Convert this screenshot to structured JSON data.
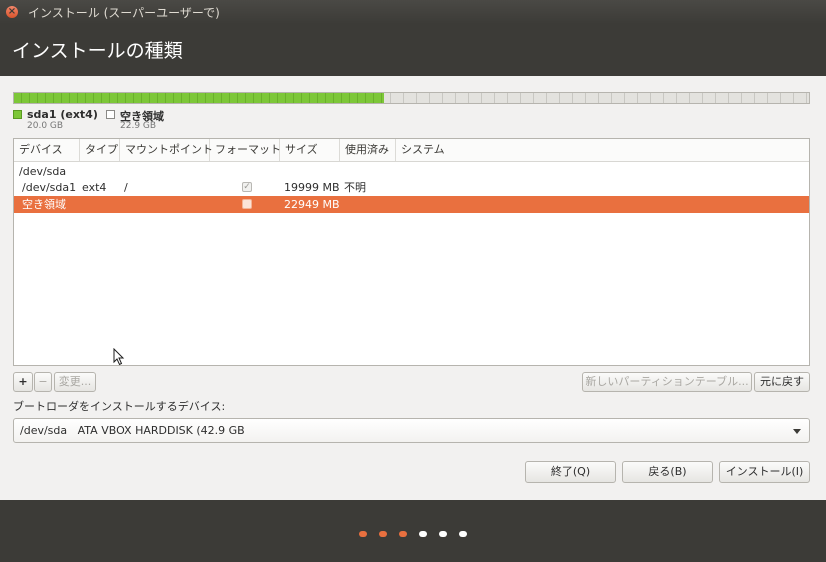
{
  "window": {
    "title": "インストール (スーパーユーザーで)",
    "close_icon": "close-icon"
  },
  "header": {
    "title": "インストールの種類"
  },
  "partition_bar": {
    "used_fraction": 0.466,
    "used_color": "#7dc738"
  },
  "legend": [
    {
      "name": "sda1 (ext4)",
      "size": "20.0 GB",
      "color": "#7dc738"
    },
    {
      "name": "空き領域",
      "size": "22.9 GB",
      "color": "#ffffff"
    }
  ],
  "table": {
    "columns": [
      "デバイス",
      "タイプ",
      "マウントポイント",
      "フォーマット",
      "サイズ",
      "使用済み",
      "システム"
    ],
    "rows": [
      {
        "device": "/dev/sda"
      },
      {
        "device": "/dev/sda1",
        "type": "ext4",
        "mount": "/",
        "format": true,
        "size": "19999 MB",
        "used": "不明"
      },
      {
        "device": "空き領域",
        "format": false,
        "size": "22949 MB",
        "selected": true
      }
    ]
  },
  "buttons": {
    "add": "+",
    "remove": "−",
    "change": "変更...",
    "new_table": "新しいパーティションテーブル...",
    "revert": "元に戻す",
    "quit": "終了(Q)",
    "back": "戻る(B)",
    "install": "インストール(I)"
  },
  "bootloader": {
    "label": "ブートローダをインストールするデバイス:",
    "device": "/dev/sda",
    "description": "ATA VBOX HARDDISK (42.9 GB"
  },
  "progress": {
    "total": 6,
    "done": 3,
    "done_color": "#e9703f",
    "todo_color": "#ffffff"
  }
}
